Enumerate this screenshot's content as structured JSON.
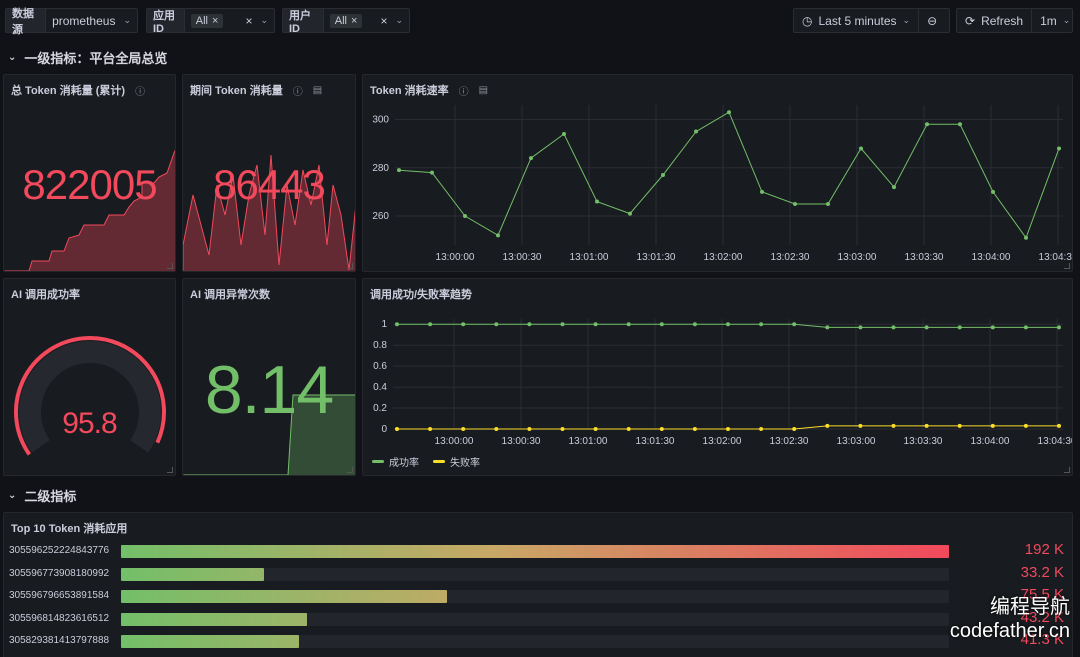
{
  "toolbar": {
    "datasource_label": "数据源",
    "datasource_value": "prometheus",
    "app_label": "应用ID",
    "app_value": "All",
    "user_label": "用户ID",
    "user_value": "All",
    "time_range": "Last 5 minutes",
    "refresh_label": "Refresh",
    "refresh_interval": "1m"
  },
  "rows": [
    {
      "title": "一级指标：平台全局总览"
    },
    {
      "title": "二级指标"
    }
  ],
  "panels": {
    "total_tokens": {
      "title": "总 Token 消耗量 (累计)",
      "value": "822005",
      "color": "#f2495c"
    },
    "period_tokens": {
      "title": "期间 Token 消耗量",
      "value": "86443",
      "color": "#f2495c"
    },
    "token_rate": {
      "title": "Token 消耗速率"
    },
    "success_rate": {
      "title": "AI 调用成功率",
      "value": "95.8",
      "percent": 95.8,
      "color": "#f2495c"
    },
    "error_count": {
      "title": "AI 调用异常次数",
      "value": "8.14",
      "color": "#73bf69"
    },
    "trend": {
      "title": "调用成功/失败率趋势",
      "legend_success": "成功率",
      "legend_fail": "失败率"
    },
    "top10": {
      "title": "Top 10 Token 消耗应用"
    }
  },
  "chart_data": [
    {
      "type": "line",
      "title": "Token 消耗速率",
      "x_ticks": [
        "13:00:00",
        "13:00:30",
        "13:01:00",
        "13:01:30",
        "13:02:00",
        "13:02:30",
        "13:03:00",
        "13:03:30",
        "13:04:00",
        "13:04:30"
      ],
      "y_ticks": [
        260,
        280,
        300
      ],
      "ylim": [
        248,
        306
      ],
      "series": [
        {
          "color": "#73bf69",
          "values": [
            279,
            278,
            260,
            252,
            284,
            294,
            266,
            261,
            277,
            295,
            303,
            270,
            265,
            265,
            288,
            272,
            298,
            298,
            270,
            251,
            288
          ]
        }
      ]
    },
    {
      "type": "line",
      "title": "调用成功/失败率趋势",
      "x_ticks": [
        "13:00:00",
        "13:00:30",
        "13:01:00",
        "13:01:30",
        "13:02:00",
        "13:02:30",
        "13:03:00",
        "13:03:30",
        "13:04:00",
        "13:04:30"
      ],
      "y_ticks": [
        0,
        0.2,
        0.4,
        0.6,
        0.8,
        1
      ],
      "ylim": [
        0,
        1.05
      ],
      "series": [
        {
          "name": "成功率",
          "color": "#73bf69",
          "values": [
            1,
            1,
            1,
            1,
            1,
            1,
            1,
            1,
            1,
            1,
            1,
            1,
            1,
            0.97,
            0.97,
            0.97,
            0.97,
            0.97,
            0.97,
            0.97,
            0.97
          ]
        },
        {
          "name": "失败率",
          "color": "#fade2a",
          "values": [
            0,
            0,
            0,
            0,
            0,
            0,
            0,
            0,
            0,
            0,
            0,
            0,
            0,
            0.03,
            0.03,
            0.03,
            0.03,
            0.03,
            0.03,
            0.03,
            0.03
          ]
        }
      ]
    },
    {
      "type": "bar",
      "title": "Top 10 Token 消耗应用",
      "categories": [
        "305596252224843776",
        "305596773908180992",
        "305596796653891584",
        "305596814823616512",
        "305829381413797888"
      ],
      "values": [
        192,
        33.2,
        75.5,
        43.2,
        41.3
      ],
      "labels": [
        "192 K",
        "33.2 K",
        "75.5 K",
        "43.2 K",
        "41.3 K"
      ],
      "max": 192
    }
  ],
  "watermark": {
    "line1": "编程导航",
    "line2": "codefather.cn"
  }
}
